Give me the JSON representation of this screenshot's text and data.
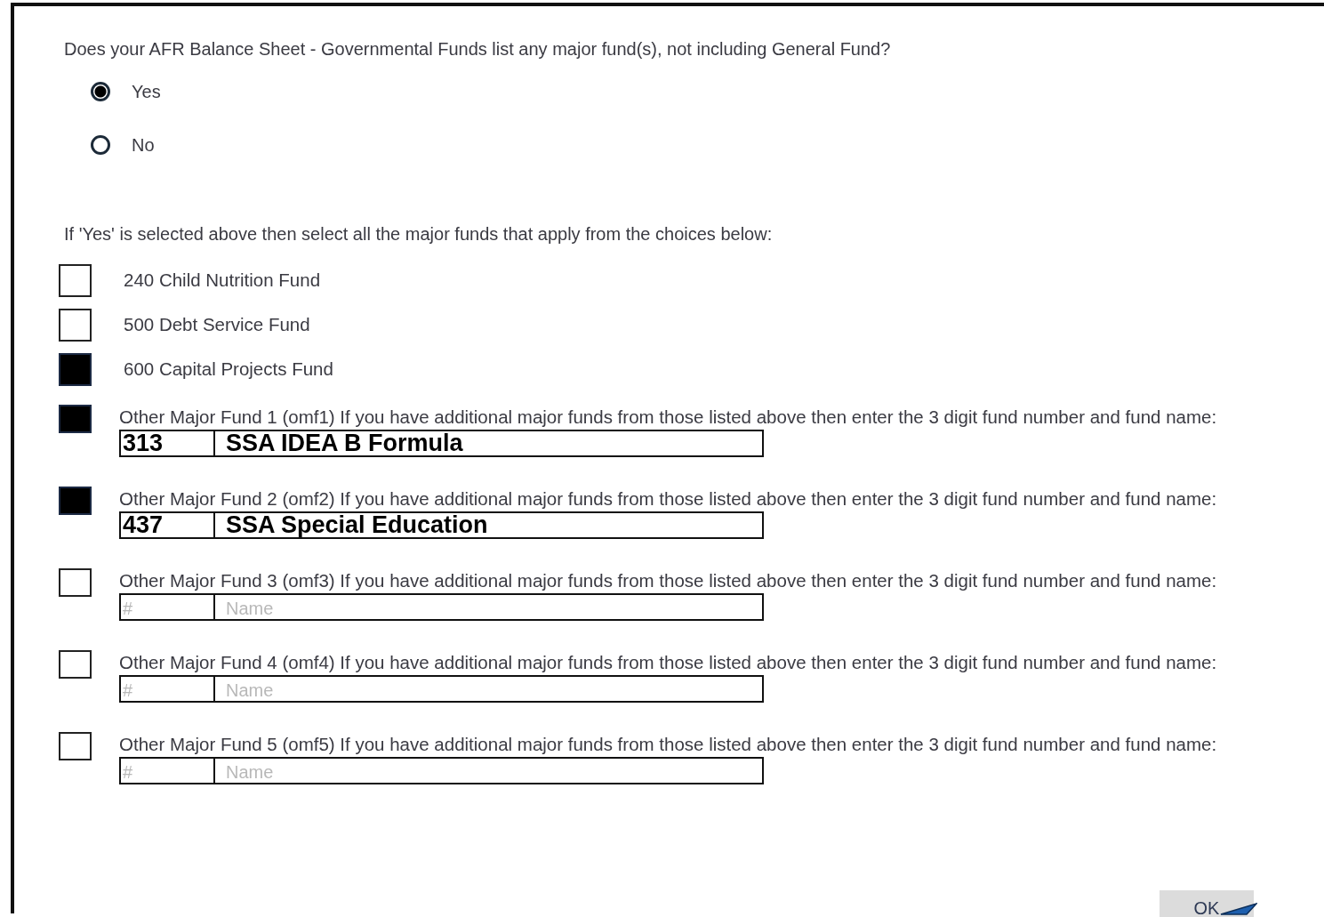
{
  "question": "Does your AFR Balance Sheet - Governmental Funds list any major fund(s), not including General Fund?",
  "options": [
    {
      "label": "Yes",
      "selected": true
    },
    {
      "label": "No",
      "selected": false
    }
  ],
  "instruction": "If 'Yes' is selected above then select all the major funds that apply from the choices below:",
  "funds": [
    {
      "kind": "checkbox",
      "label": "240 Child Nutrition Fund",
      "checked": false
    },
    {
      "kind": "checkbox",
      "label": "500 Debt Service Fund",
      "checked": false
    },
    {
      "kind": "checkbox",
      "label": "600 Capital Projects Fund",
      "checked": true
    },
    {
      "kind": "entry",
      "label": "Other Major Fund 1 (omf1) If you have additional major funds from those listed above then enter the 3 digit fund number and fund name:",
      "checked": true,
      "number": {
        "value": "313"
      },
      "name": {
        "value": "SSA IDEA B Formula"
      }
    },
    {
      "kind": "entry",
      "label": "Other Major Fund 2 (omf2) If you have additional major funds from those listed above then enter the 3 digit fund number and fund name:",
      "checked": true,
      "number": {
        "value": "437"
      },
      "name": {
        "value": "SSA Special Education"
      }
    },
    {
      "kind": "entry",
      "label": "Other Major Fund 3 (omf3) If you have additional major funds from those listed above then enter the 3 digit fund number and fund name:",
      "checked": false,
      "number": {
        "placeholder": "#"
      },
      "name": {
        "placeholder": "Name"
      }
    },
    {
      "kind": "entry",
      "label": "Other Major Fund 4 (omf4) If you have additional major funds from those listed above then enter the 3 digit fund number and fund name:",
      "checked": false,
      "number": {
        "placeholder": "#"
      },
      "name": {
        "placeholder": "Name"
      }
    },
    {
      "kind": "entry",
      "label": "Other Major Fund 5 (omf5) If you have additional major funds from those listed above then enter the 3 digit fund number and fund name:",
      "checked": false,
      "number": {
        "placeholder": "#"
      },
      "name": {
        "placeholder": "Name"
      }
    }
  ],
  "ok_button": "OK"
}
